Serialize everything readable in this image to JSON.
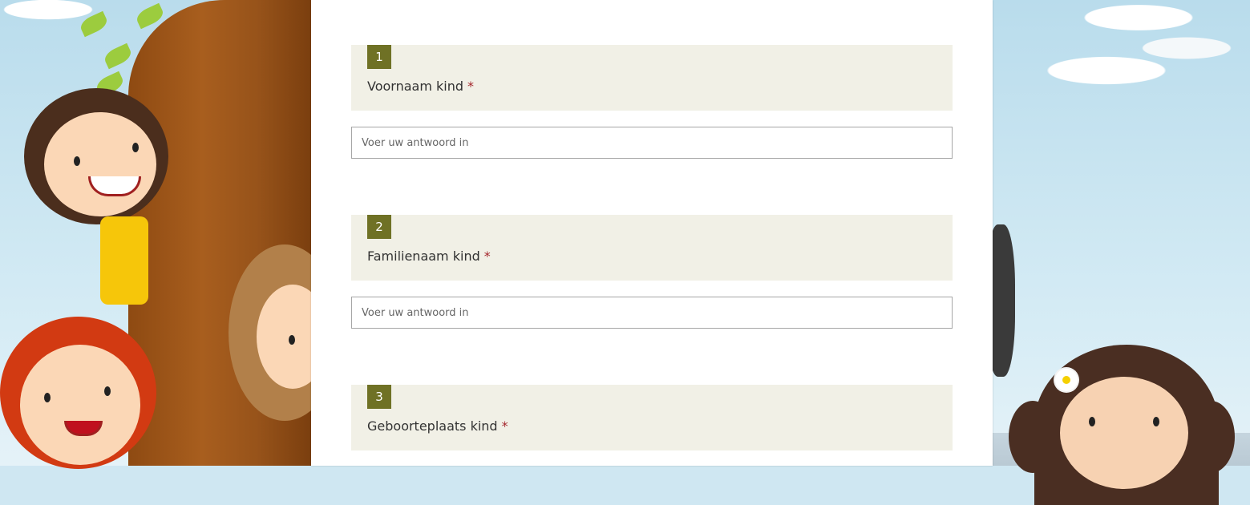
{
  "questions": [
    {
      "number": "1",
      "title": "Voornaam kind",
      "required_mark": "*",
      "placeholder": "Voer uw antwoord in"
    },
    {
      "number": "2",
      "title": "Familienaam kind",
      "required_mark": "*",
      "placeholder": "Voer uw antwoord in"
    },
    {
      "number": "3",
      "title": "Geboorteplaats kind",
      "required_mark": "*"
    }
  ],
  "colors": {
    "accent": "#6f7125",
    "question_bg": "#f1f0e6",
    "required": "#a4262c"
  }
}
